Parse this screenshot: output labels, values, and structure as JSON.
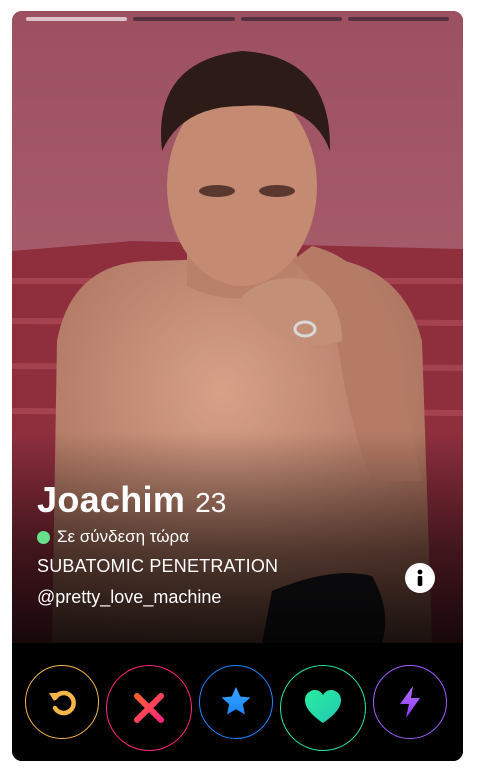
{
  "profile": {
    "name": "Joachim",
    "age": "23",
    "status": "Σε σύνδεση τώρα",
    "job": "SUBATOMIC PENETRATION",
    "handle": "@pretty_love_machine"
  },
  "progress": {
    "total": 4,
    "active": 1
  },
  "icons": {
    "info": "info-icon",
    "rewind": "rewind-icon",
    "nope": "close-icon",
    "superlike": "star-icon",
    "like": "heart-icon",
    "boost": "lightning-icon"
  },
  "colors": {
    "online": "#66e08a",
    "rewind": "#f5b748",
    "nope": "#fd267a",
    "superlike": "#1786ff",
    "like": "#2ce2a2",
    "boost": "#a05cff"
  }
}
